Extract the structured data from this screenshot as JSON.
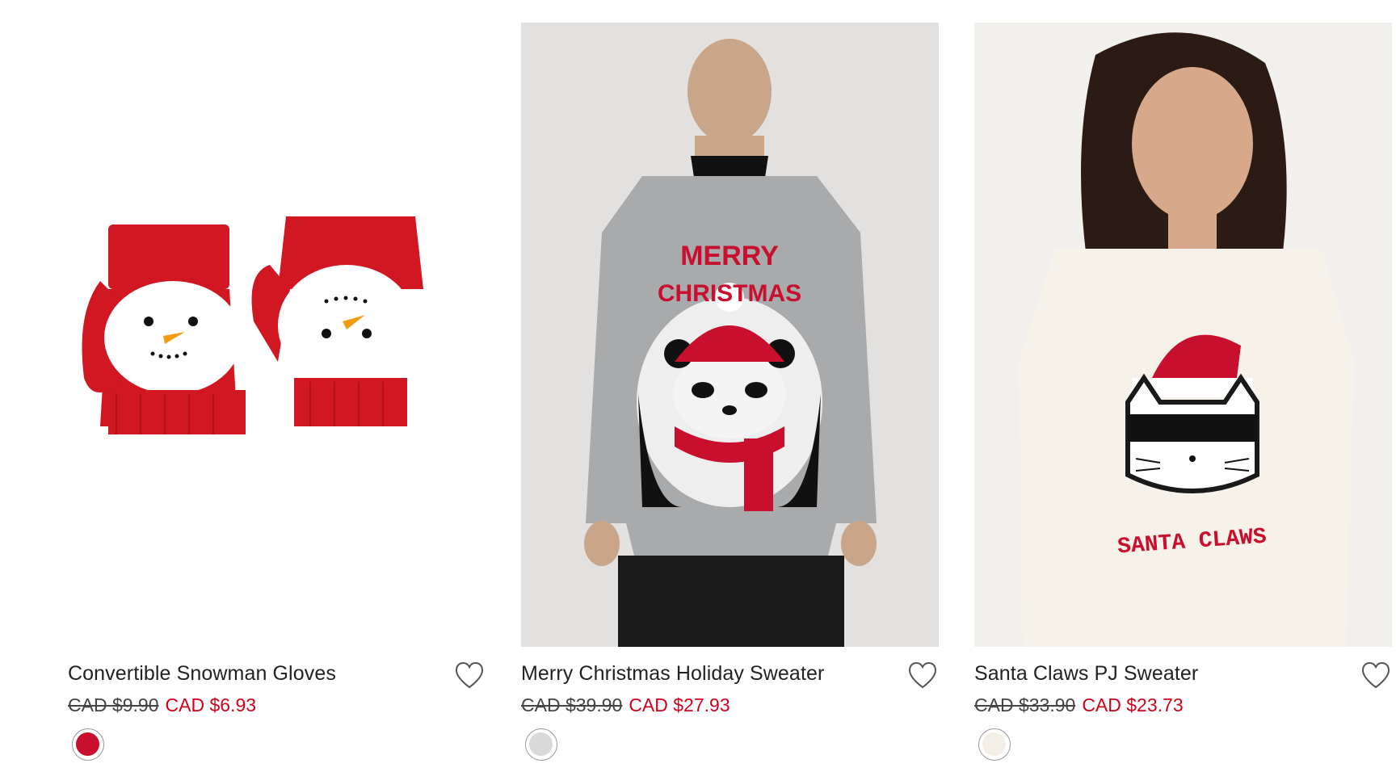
{
  "products": [
    {
      "title": "Convertible Snowman Gloves",
      "original_price": "CAD $9.90",
      "sale_price": "CAD $6.93",
      "swatch_color": "#c8102e",
      "image_icon": "snowman-gloves-image"
    },
    {
      "title": "Merry Christmas Holiday Sweater",
      "original_price": "CAD $39.90",
      "sale_price": "CAD $27.93",
      "swatch_color": "#d9d9d9",
      "image_icon": "panda-sweater-image",
      "sweater_text_top": "MERRY",
      "sweater_text_bottom": "CHRISTMAS"
    },
    {
      "title": "Santa Claws PJ Sweater",
      "original_price": "CAD $33.90",
      "sale_price": "CAD $23.73",
      "swatch_color": "#f3efe6",
      "image_icon": "cat-sweater-image",
      "sweater_text": "SANTA CLAWS"
    }
  ],
  "colors": {
    "sale_price": "#d0021b",
    "title": "#222222",
    "heart_outline": "#555555"
  },
  "icons": {
    "wishlist": "heart-icon"
  }
}
